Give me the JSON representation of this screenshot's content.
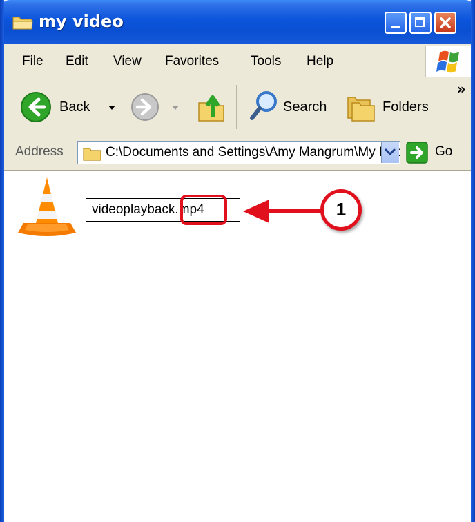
{
  "window": {
    "title": "my video"
  },
  "menubar": {
    "items": [
      "File",
      "Edit",
      "View",
      "Favorites",
      "Tools",
      "Help"
    ]
  },
  "toolbar": {
    "back_label": "Back",
    "search_label": "Search",
    "folders_label": "Folders",
    "overflow": "»"
  },
  "addressbar": {
    "label": "Address",
    "path": "C:\\Documents and Settings\\Amy Mangrum\\My Documents\\my video",
    "go_label": "Go"
  },
  "content": {
    "rename_value": "videoplayback.mp4",
    "callout_number": "1"
  },
  "colors": {
    "titlebar": "#0a4fd2",
    "chrome": "#ece9d8",
    "annotation": "#e0101c"
  }
}
